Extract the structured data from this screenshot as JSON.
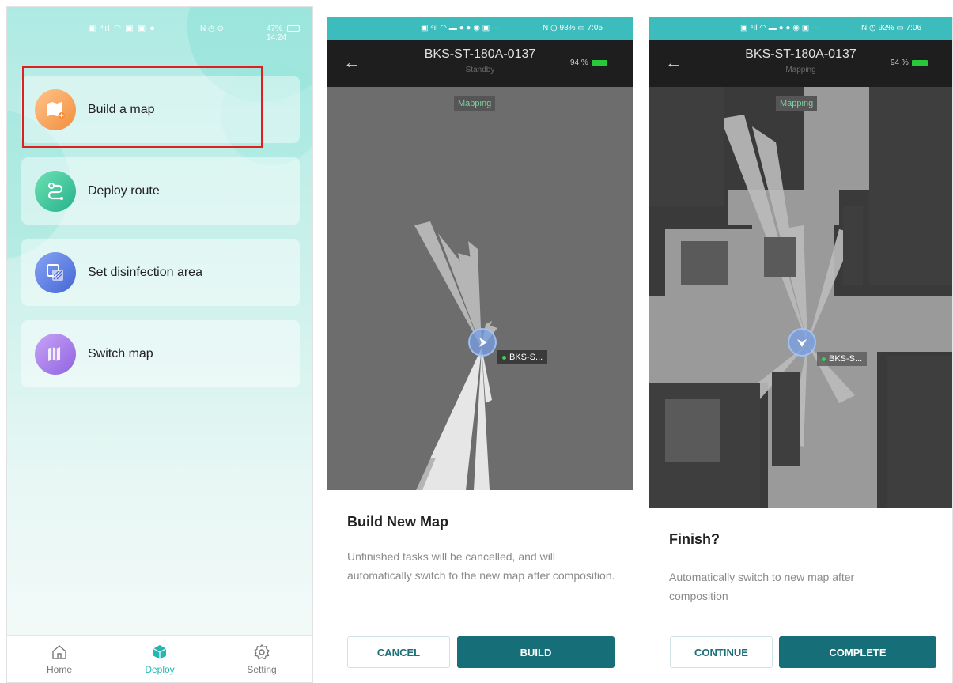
{
  "colors": {
    "accent": "#24b6b0",
    "highlight": "#e02020",
    "primary_button": "#166e78",
    "status_bar": "#3cbcbc",
    "map_bg": "#6d6d6d"
  },
  "panel1": {
    "status": {
      "right_text": "47%",
      "time": "14:24"
    },
    "menu": [
      {
        "label": "Build a map",
        "icon": "map-plus-icon",
        "color": "#f5a45a"
      },
      {
        "label": "Deploy route",
        "icon": "route-icon",
        "color": "#36c38f"
      },
      {
        "label": "Set disinfection area",
        "icon": "area-icon",
        "color": "#5b7fe0"
      },
      {
        "label": "Switch map",
        "icon": "switch-map-icon",
        "color": "#a37ae0"
      }
    ],
    "tabs": [
      {
        "label": "Home",
        "icon": "home-icon"
      },
      {
        "label": "Deploy",
        "icon": "deploy-icon"
      },
      {
        "label": "Setting",
        "icon": "gear-icon"
      }
    ]
  },
  "panel2": {
    "status": {
      "time": "7:05",
      "battery": "93%"
    },
    "device_name": "BKS-ST-180A-0137",
    "device_state": "Standby",
    "battery": "94 %",
    "map_tag": "Mapping",
    "robot_label": "BKS-S...",
    "dialog": {
      "title": "Build New Map",
      "text": "Unfinished tasks will be cancelled, and will automatically switch to the new map after composition.",
      "cancel": "CANCEL",
      "confirm": "BUILD"
    }
  },
  "panel3": {
    "status": {
      "time": "7:06",
      "battery": "92%"
    },
    "device_name": "BKS-ST-180A-0137",
    "device_state": "Mapping",
    "battery": "94 %",
    "map_tag": "Mapping",
    "robot_label": "BKS-S...",
    "dialog": {
      "title": "Finish?",
      "text": "Automatically switch to new map after composition",
      "cancel": "CONTINUE",
      "confirm": "COMPLETE"
    }
  }
}
